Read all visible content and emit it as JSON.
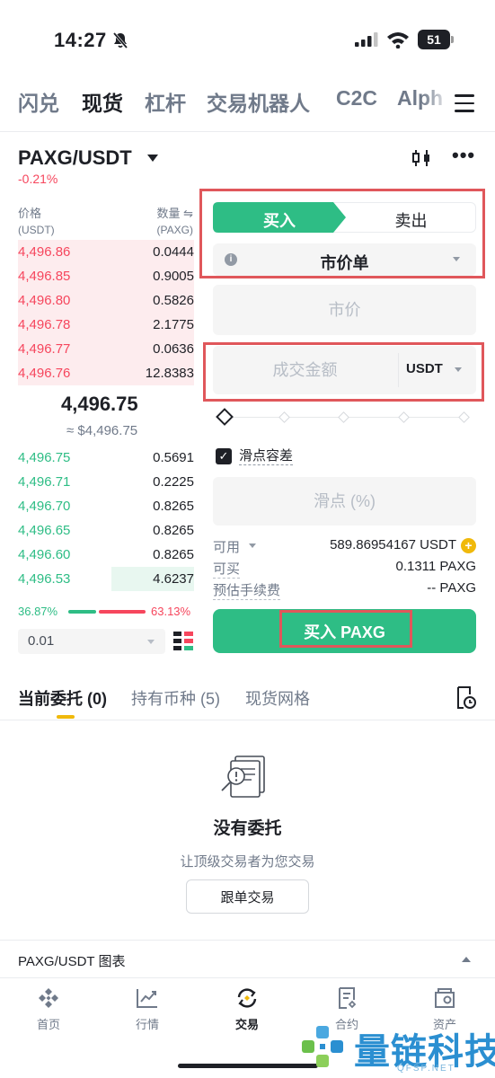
{
  "status_bar": {
    "time": "14:27",
    "battery": "51"
  },
  "top_tabs": [
    "闪兑",
    "现货",
    "杠杆",
    "交易机器人",
    "C2C",
    "Alph"
  ],
  "top_tabs_active": "现货",
  "pair": {
    "symbol": "PAXG/USDT",
    "change": "-0.21%"
  },
  "order_book": {
    "price_header": "价格",
    "price_unit": "(USDT)",
    "qty_header": "数量 ⇋",
    "qty_unit": "(PAXG)",
    "asks": [
      {
        "price": "4,496.86",
        "qty": "0.0444"
      },
      {
        "price": "4,496.85",
        "qty": "0.9005"
      },
      {
        "price": "4,496.80",
        "qty": "0.5826"
      },
      {
        "price": "4,496.78",
        "qty": "2.1775"
      },
      {
        "price": "4,496.77",
        "qty": "0.0636"
      },
      {
        "price": "4,496.76",
        "qty": "12.8383"
      }
    ],
    "ask_depth_fraction": [
      1,
      1,
      1,
      1,
      1,
      1
    ],
    "mid_price": "4,496.75",
    "mid_fiat": "≈ $4,496.75",
    "bids": [
      {
        "price": "4,496.75",
        "qty": "0.5691"
      },
      {
        "price": "4,496.71",
        "qty": "0.2225"
      },
      {
        "price": "4,496.70",
        "qty": "0.8265"
      },
      {
        "price": "4,496.65",
        "qty": "0.8265"
      },
      {
        "price": "4,496.60",
        "qty": "0.8265"
      },
      {
        "price": "4,496.53",
        "qty": "4.6237"
      }
    ],
    "bid_depth_fraction": [
      0,
      0,
      0,
      0,
      0,
      0.47
    ],
    "buy_ratio": "36.87%",
    "sell_ratio": "63.13%",
    "precision": "0.01"
  },
  "trade_form": {
    "buy_label": "买入",
    "sell_label": "卖出",
    "order_type": "市价单",
    "price_placeholder": "市价",
    "amount_placeholder": "成交金额",
    "amount_unit": "USDT",
    "slider_percent": 0,
    "slippage_label": "滑点容差",
    "slippage_placeholder": "滑点 (%)",
    "available_label": "可用",
    "available_value": "589.86954167 USDT",
    "can_buy_label": "可买",
    "can_buy_value": "0.1311 PAXG",
    "fee_label": "预估手续费",
    "fee_value": "-- PAXG",
    "submit_label": "买入 PAXG"
  },
  "orders": {
    "tabs": [
      "当前委托 (0)",
      "持有币种 (5)",
      "现货网格"
    ],
    "empty_title": "没有委托",
    "empty_subtitle": "让顶级交易者为您交易",
    "copy_button": "跟单交易"
  },
  "chart_bar": {
    "label": "PAXG/USDT 图表"
  },
  "bottom_nav": [
    "首页",
    "行情",
    "交易",
    "合约",
    "资产"
  ],
  "bottom_nav_active": "交易",
  "watermark": {
    "text": "量链科技",
    "sub": "QFSP.NET"
  },
  "colors": {
    "buy": "#2ebd85",
    "sell": "#f6465d",
    "accent": "#f0b90b",
    "annotation": "#e0575b"
  }
}
